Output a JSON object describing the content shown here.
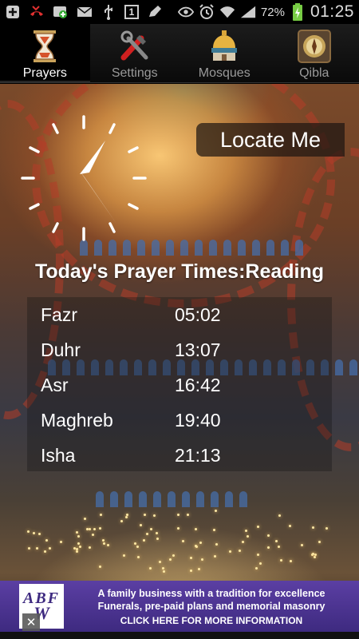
{
  "statusbar": {
    "icons": [
      "plus-icon",
      "missed-call-icon",
      "gallery-icon",
      "email-icon",
      "usb-icon",
      "calendar-icon",
      "pen-icon",
      "eye-icon",
      "alarm-icon",
      "wifi-icon",
      "signal-icon"
    ],
    "calendar_day": "1",
    "battery_percent": "72%",
    "time": "01:25"
  },
  "tabs": [
    {
      "label": "Prayers",
      "icon": "hourglass-icon",
      "active": true
    },
    {
      "label": "Settings",
      "icon": "tools-icon",
      "active": false
    },
    {
      "label": "Mosques",
      "icon": "mosque-icon",
      "active": false
    },
    {
      "label": "Qibla",
      "icon": "compass-icon",
      "active": false
    }
  ],
  "locate_button": "Locate Me",
  "prayer_title": "Today's Prayer Times:Reading",
  "prayers": [
    {
      "name": "Fazr",
      "time": "05:02"
    },
    {
      "name": "Duhr",
      "time": "13:07"
    },
    {
      "name": "Asr",
      "time": "16:42"
    },
    {
      "name": "Maghreb",
      "time": "19:40"
    },
    {
      "name": "Isha",
      "time": "21:13"
    }
  ],
  "ad": {
    "logo_top": "ABF",
    "logo_bottom": "W",
    "line1": "A family business with a tradition for excellence",
    "line2": "Funerals, pre-paid plans and memorial masonry",
    "line3": "CLICK HERE FOR MORE INFORMATION",
    "close": "✕"
  }
}
